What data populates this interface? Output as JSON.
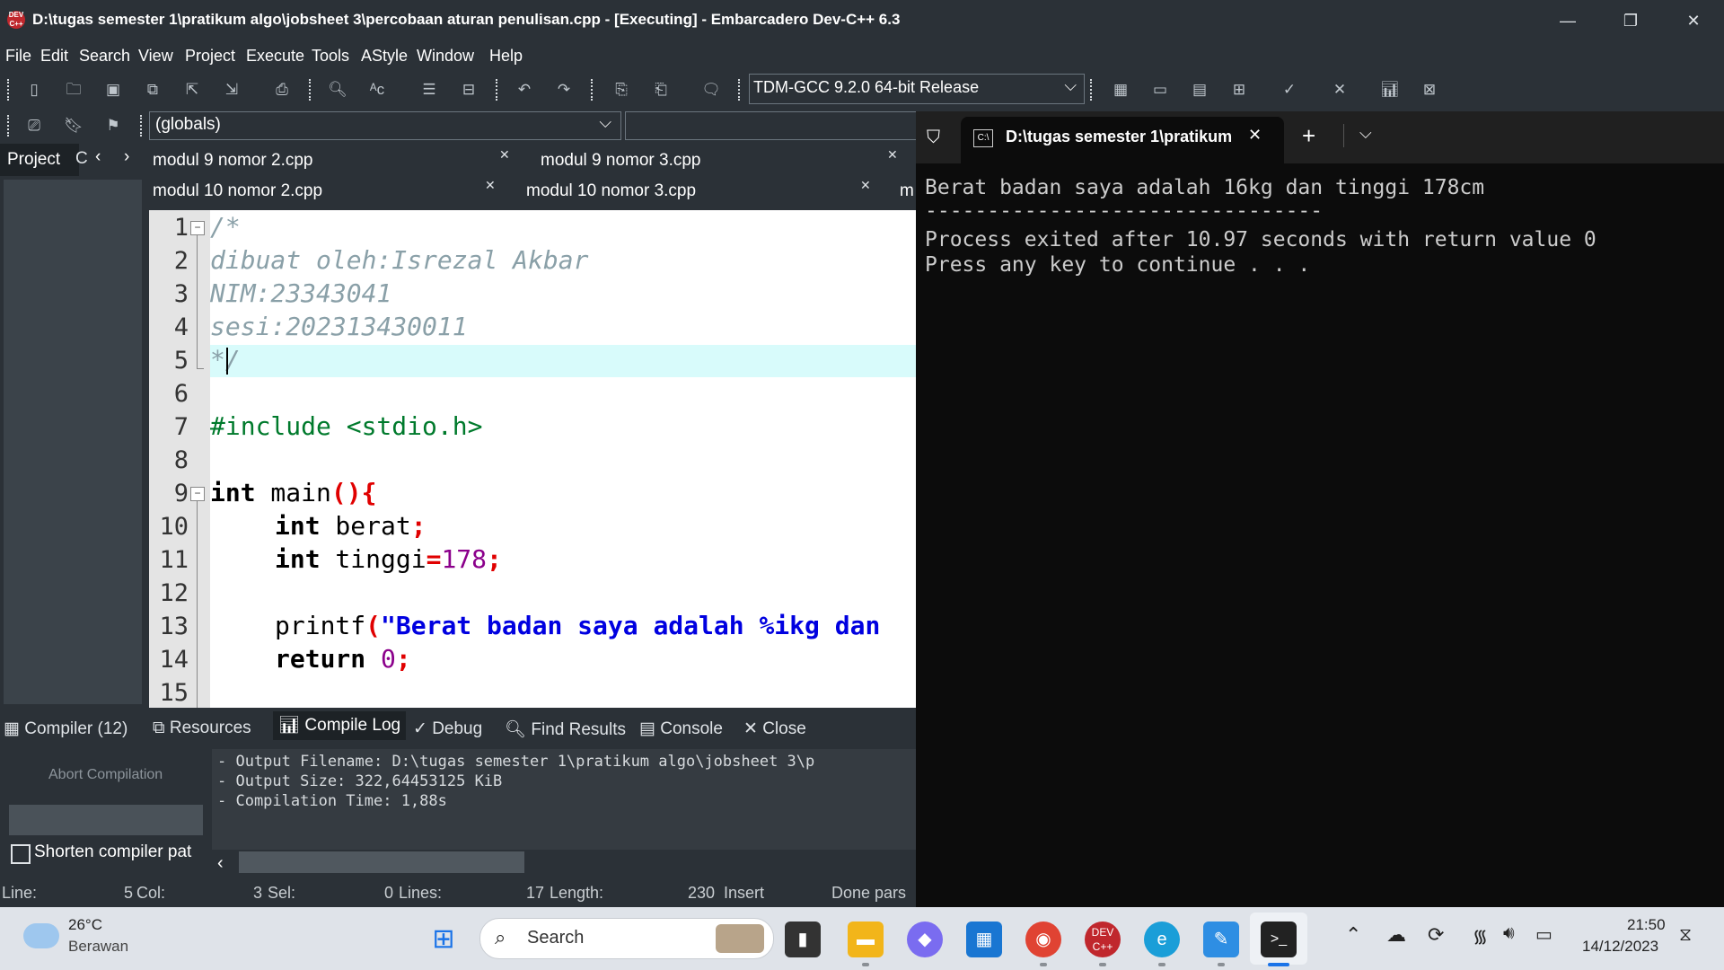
{
  "window": {
    "title": "D:\\tugas semester 1\\pratikum algo\\jobsheet 3\\percobaan aturan penulisan.cpp - [Executing] - Embarcadero Dev-C++ 6.3",
    "icon_text": "DEV C++",
    "minimize": "—",
    "restore": "❐",
    "close": "✕"
  },
  "menu": [
    "File",
    "Edit",
    "Search",
    "View",
    "Project",
    "Execute",
    "Tools",
    "AStyle",
    "Window",
    "Help"
  ],
  "toolbar": {
    "compiler": "TDM-GCC 9.2.0 64-bit Release",
    "scope": "(globals)"
  },
  "left_panel": {
    "tab_project": "Project",
    "tab_classes": "C"
  },
  "editor_tabs": [
    {
      "label": "modul 9 nomor 2.cpp"
    },
    {
      "label": "modul 9 nomor 3.cpp"
    },
    {
      "label": "modul 10 nomor 2.cpp"
    },
    {
      "label": "modul 10 nomor 3.cpp"
    },
    {
      "label": "m"
    }
  ],
  "code": {
    "line_numbers": [
      "1",
      "2",
      "3",
      "4",
      "5",
      "6",
      "7",
      "8",
      "9",
      "10",
      "11",
      "12",
      "13",
      "14",
      "15"
    ],
    "l1": "/*",
    "l2": "dibuat oleh:Isrezal Akbar",
    "l3": "NIM:23343041",
    "l4": "sesi:202313430011",
    "l5": "*/",
    "l7": "#include <stdio.h>",
    "l9_kw": "int",
    "l9_name": " main",
    "l9_sym": "(){",
    "l10_kw": "int",
    "l10_name": " berat",
    "l10_sym": ";",
    "l11_kw": "int",
    "l11_name": " tinggi",
    "l11_eq": "=",
    "l11_num": "178",
    "l11_sym": ";",
    "l13_name": "printf",
    "l13_paren": "(",
    "l13_str": "\"Berat badan saya adalah %ikg dan",
    "l14_kw": "return",
    "l14_num": "0",
    "l14_sym": ";"
  },
  "bottom_tabs": [
    "Compiler (12)",
    "Resources",
    "Compile Log",
    "Debug",
    "Find Results",
    "Console",
    "Close"
  ],
  "bottom_left": {
    "abort": "Abort Compilation",
    "shorten": "Shorten compiler pat"
  },
  "log": [
    "- Output Filename: D:\\tugas semester 1\\pratikum algo\\jobsheet 3\\p",
    "- Output Size: 322,64453125 KiB",
    "- Compilation Time: 1,88s"
  ],
  "status": {
    "line_label": "Line:",
    "line_val": "5",
    "col_label": "Col:",
    "col_val": "3",
    "sel_label": "Sel:",
    "sel_val": "0",
    "lines_label": "Lines:",
    "lines_val": "17",
    "length_label": "Length:",
    "length_val": "230",
    "mode": "Insert",
    "message": "Done pars"
  },
  "terminal": {
    "tab_title": "D:\\tugas semester 1\\pratikum",
    "output": [
      "Berat badan saya adalah 16kg dan tinggi 178cm",
      "--------------------------------",
      "Process exited after 10.97 seconds with return value 0",
      "Press any key to continue . . ."
    ]
  },
  "taskbar": {
    "weather_temp": "26°C",
    "weather_desc": "Berawan",
    "search_placeholder": "Search",
    "time": "21:50",
    "date": "14/12/2023"
  },
  "colors": {
    "ide_bg": "#2b3137",
    "editor_bg": "#ffffff",
    "current_line": "#d8fbfb",
    "comment": "#8aa0a8",
    "preprocessor": "#007a2c",
    "string": "#0000e0",
    "symbol": "#e00000",
    "number": "#8b008b",
    "terminal_bg": "#0c0c0c",
    "taskbar_bg": "#dfe3e9"
  }
}
